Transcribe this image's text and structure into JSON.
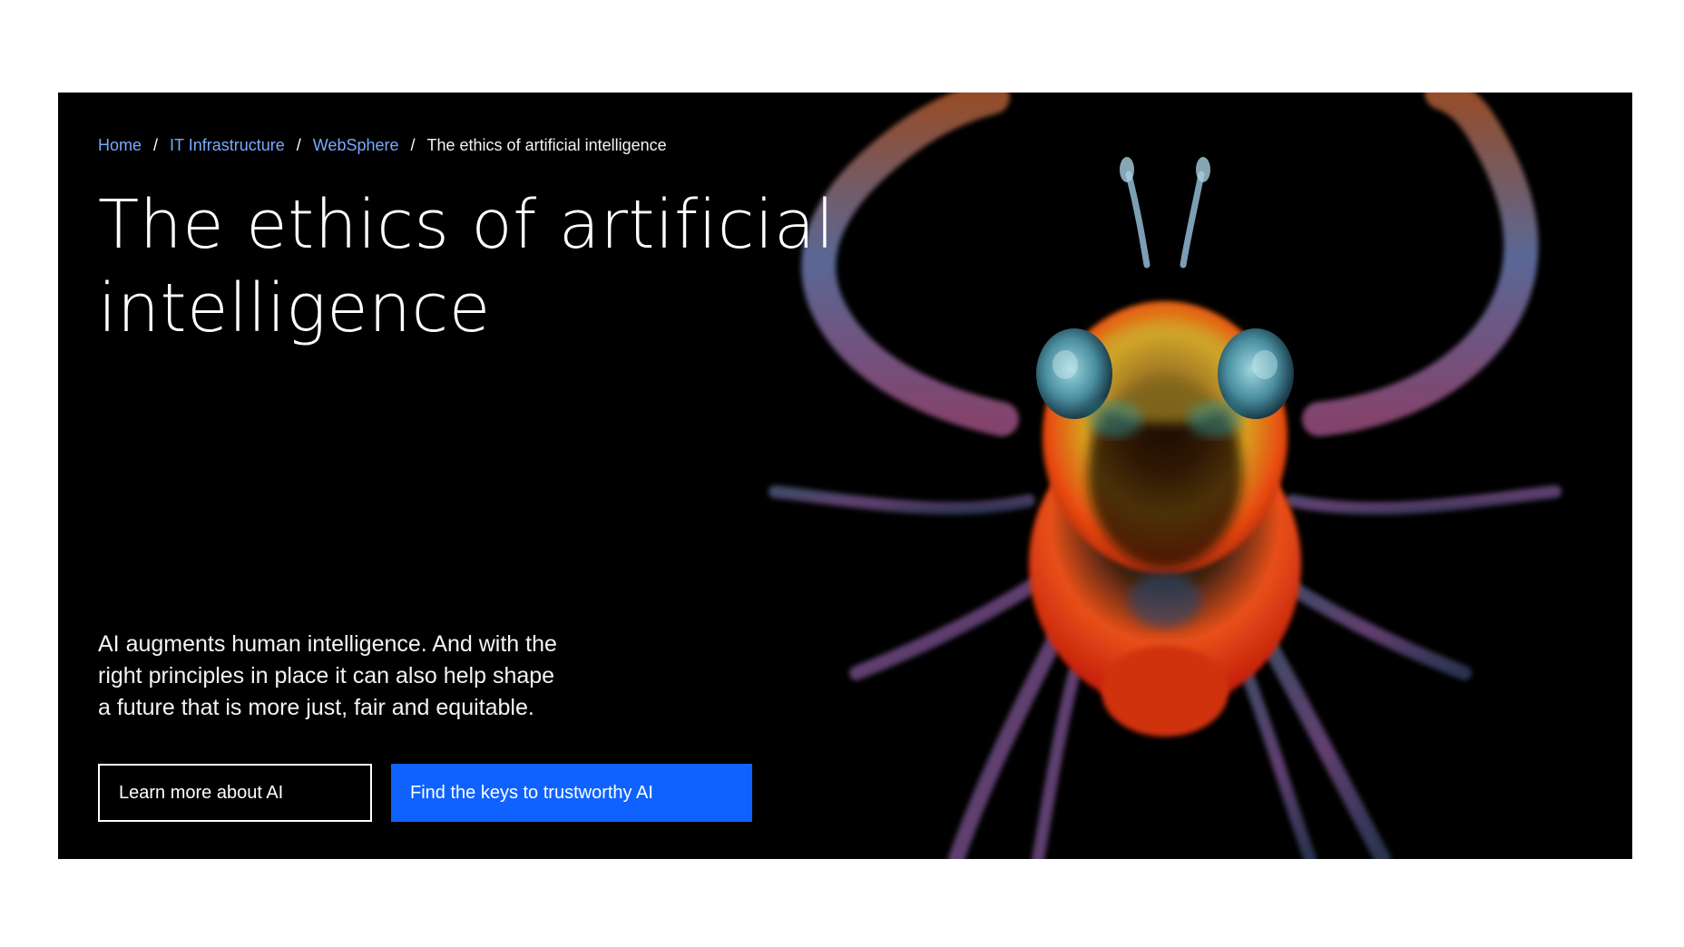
{
  "breadcrumb": {
    "items": [
      {
        "label": "Home"
      },
      {
        "label": "IT Infrastructure"
      },
      {
        "label": "WebSphere"
      }
    ],
    "separator": "/",
    "current": "The ethics of artificial intelligence"
  },
  "hero": {
    "title_line1": "The ethics of artificial",
    "title_line2": "intelligence",
    "description_line1": "AI augments human intelligence. And with the",
    "description_line2": "right principles in place it can also help shape",
    "description_line3": "a future that is more just, fair and equitable.",
    "background_color": "#000000",
    "image_subject": "creature-macro-photo"
  },
  "actions": {
    "secondary_label": "Learn more about AI",
    "primary_label": "Find the keys to trustworthy AI",
    "primary_color": "#0f62fe",
    "link_color": "#78a9ff"
  }
}
